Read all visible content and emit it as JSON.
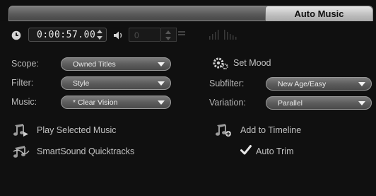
{
  "window": {
    "title": "Auto Music"
  },
  "timecode": {
    "value": "0:00:57.00"
  },
  "volume": {
    "value": "0"
  },
  "fields": {
    "scope": {
      "label": "Scope:",
      "value": "Owned Titles"
    },
    "filter": {
      "label": "Filter:",
      "value": "Style"
    },
    "music": {
      "label": "Music:",
      "value": "* Clear Vision"
    },
    "subfilter": {
      "label": "Subfilter:",
      "value": "New Age/Easy"
    },
    "variation": {
      "label": "Variation:",
      "value": "Parallel"
    }
  },
  "actions": {
    "set_mood": "Set Mood",
    "play_selected": "Play Selected Music",
    "add_to_timeline": "Add to Timeline",
    "smartsound": "SmartSound Quicktracks"
  },
  "auto_trim": {
    "label": "Auto Trim",
    "checked": true
  },
  "icons": {
    "clock": "clock-icon",
    "speaker": "speaker-icon",
    "gear": "gear-icon",
    "music_note": "music-note-icon",
    "checkmark": "checkmark-icon"
  },
  "colors": {
    "background": "#101010",
    "dropdown": "#5d5d5d",
    "text": "#c2c2c2",
    "tab": "#d0d0d0"
  }
}
